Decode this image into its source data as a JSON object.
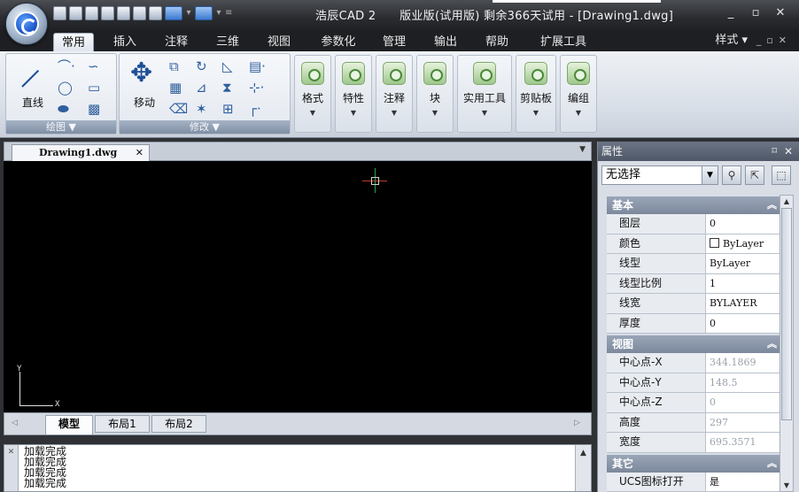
{
  "window": {
    "title": "浩辰CAD 2　　版业版(试用版) 剩余366天试用 - [Drawing1.dwg]",
    "controls": [
      "_",
      "▫",
      "✕"
    ]
  },
  "ribbon": {
    "tabs": [
      "常用",
      "插入",
      "注释",
      "三维",
      "视图",
      "参数化",
      "管理",
      "输出",
      "帮助",
      "扩展工具"
    ],
    "style_menu": "样式 ▾",
    "draw_group": {
      "line_label": "直线",
      "group_label": "绘图 ▼"
    },
    "modify_group": {
      "move_label": "移动",
      "group_label": "修改 ▼"
    },
    "panels": [
      "格式",
      "特性",
      "注释",
      "块",
      "实用工具",
      "剪贴板",
      "编组"
    ]
  },
  "document": {
    "tab_label": "Drawing1.dwg",
    "tab_close": "✕",
    "ucs_x": "X",
    "ucs_y": "Y"
  },
  "layout_tabs": [
    "模型",
    "布局1",
    "布局2"
  ],
  "command_line": {
    "lines": [
      "加载完成",
      "加载完成",
      "加载完成",
      "加载完成"
    ]
  },
  "properties": {
    "title": "属性",
    "selection": "无选择",
    "sections": [
      {
        "name": "基本",
        "rows": [
          {
            "name": "图层",
            "value": "0"
          },
          {
            "name": "颜色",
            "value": "ByLayer"
          },
          {
            "name": "线型",
            "value": "ByLayer"
          },
          {
            "name": "线型比例",
            "value": "1"
          },
          {
            "name": "线宽",
            "value": "BYLAYER"
          },
          {
            "name": "厚度",
            "value": "0"
          }
        ]
      },
      {
        "name": "视图",
        "rows": [
          {
            "name": "中心点-X",
            "value": "344.1869"
          },
          {
            "name": "中心点-Y",
            "value": "148.5"
          },
          {
            "name": "中心点-Z",
            "value": "0"
          },
          {
            "name": "高度",
            "value": "297"
          },
          {
            "name": "宽度",
            "value": "695.3571"
          }
        ]
      },
      {
        "name": "其它",
        "rows": [
          {
            "name": "UCS图标打开",
            "value": "是"
          }
        ]
      }
    ]
  },
  "colors": {
    "canvas_bg": "#000000",
    "ribbon_accent": "#2f5f9f",
    "crosshair_red": "#c0392b",
    "crosshair_green": "#2ea043"
  }
}
